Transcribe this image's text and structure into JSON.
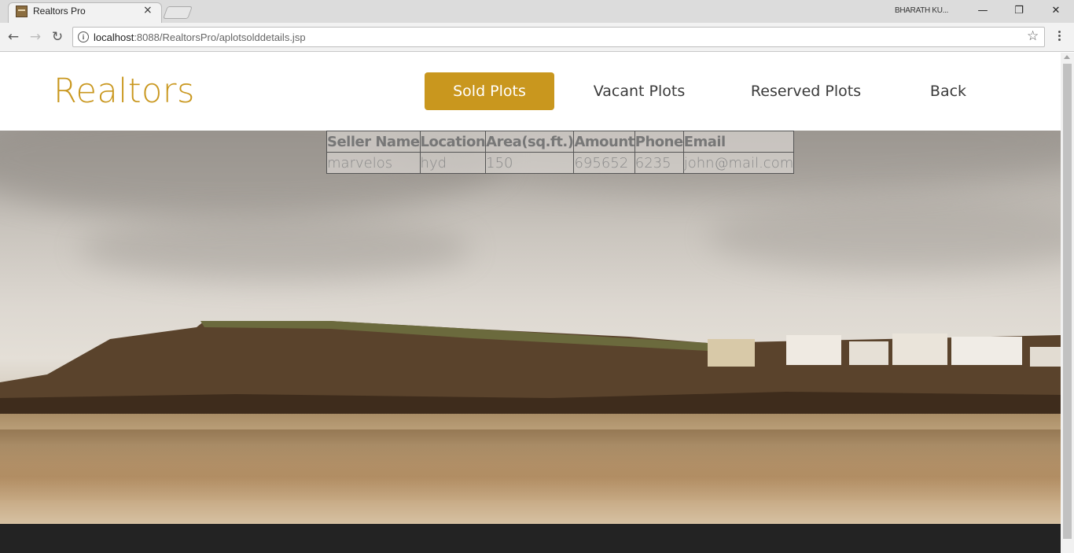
{
  "browser": {
    "tab_title": "Realtors Pro",
    "tab_close": "×",
    "user_label": "BHARATH KU...",
    "window_controls": {
      "minimize": "—",
      "restore": "❐",
      "close": "✕"
    },
    "nav": {
      "back": "←",
      "forward": "→",
      "reload": "↻"
    },
    "info_icon": "i",
    "url_host": "localhost",
    "url_rest": ":8088/RealtorsPro/aplotsolddetails.jsp",
    "star": "☆"
  },
  "page": {
    "logo": "Realtors",
    "nav_items": [
      {
        "label": "Sold Plots",
        "active": true
      },
      {
        "label": "Vacant Plots",
        "active": false
      },
      {
        "label": "Reserved Plots",
        "active": false
      },
      {
        "label": "Back",
        "active": false
      }
    ],
    "table": {
      "headers": [
        "Seller Name",
        "Location",
        "Area(sq.ft.)",
        "Amount",
        "Phone",
        "Email"
      ],
      "rows": [
        [
          "marvelos",
          "hyd",
          "150",
          "695652",
          "6235",
          "john@mail.com"
        ]
      ]
    }
  },
  "colors": {
    "accent": "#c9971e",
    "footer": "#232323"
  }
}
